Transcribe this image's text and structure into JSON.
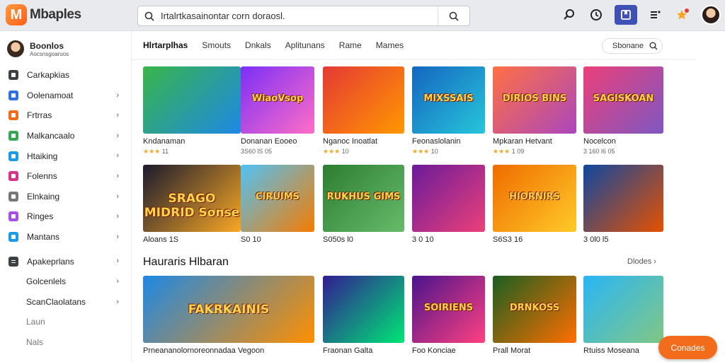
{
  "header": {
    "logo_letter": "M",
    "logo_text": "Mbaples",
    "search_value": "Irtalrtkasainontar corn doraosl.",
    "icons": [
      "magnify-icon",
      "history-icon",
      "library-icon",
      "menu-icon",
      "star-badge-icon",
      "user-avatar"
    ]
  },
  "sidebar": {
    "profile_name": "Boonlos",
    "profile_sub": "Aocsnsgoaruos",
    "items": [
      {
        "label": "Carkapkias",
        "icon_color": "#3c4043",
        "chevron": false
      },
      {
        "label": "Oolenamoat",
        "icon_color": "#2f6fde",
        "chevron": true
      },
      {
        "label": "Frtrras",
        "icon_color": "#f36c1c",
        "chevron": true
      },
      {
        "label": "Malkancaalo",
        "icon_color": "#34a853",
        "chevron": true
      },
      {
        "label": "Htaiking",
        "icon_color": "#1a9be6",
        "chevron": true
      },
      {
        "label": "Folenns",
        "icon_color": "#d63384",
        "chevron": true
      },
      {
        "label": "Elnkaing",
        "icon_color": "#777777",
        "chevron": true
      },
      {
        "label": "Ringes",
        "icon_color": "#a64ee6",
        "chevron": true
      },
      {
        "label": "Mantans",
        "icon_color": "#1a9be6",
        "chevron": true
      }
    ],
    "items2": [
      {
        "label": "Apakeprlans",
        "chevron": true
      },
      {
        "label": "Golcenlels",
        "chevron": true
      },
      {
        "label": "ScanClaolatans",
        "chevron": true
      },
      {
        "label": "Laun",
        "chevron": false
      },
      {
        "label": "Nals",
        "chevron": false
      }
    ]
  },
  "tabs": [
    "Hlrtarplhas",
    "Smouts",
    "Dnkals",
    "Aplitunans",
    "Rame",
    "Mames"
  ],
  "sort": {
    "label": "Sbonane"
  },
  "row1": [
    {
      "title": "Kndanaman",
      "meta": "11",
      "rating": 3,
      "ttl": "",
      "bg": "linear-gradient(135deg,#39b54a,#1e88e5)"
    },
    {
      "title": "Donanan Eooeo",
      "meta": "3S60 lS 05",
      "rating": 0,
      "ttl": "WiaoVsop",
      "bg": "linear-gradient(135deg,#7b2ff7,#ff6ec7)"
    },
    {
      "title": "Nganoc Inoatlat",
      "meta": "10",
      "rating": 3,
      "ttl": "",
      "bg": "linear-gradient(135deg,#e53935,#ff9800)"
    },
    {
      "title": "Feonaslolanin",
      "meta": "10",
      "rating": 3,
      "ttl": "MIXSSAIS",
      "bg": "linear-gradient(135deg,#1565c0,#26c6da)"
    },
    {
      "title": "Mpkaran Hetvant",
      "meta": "1 09",
      "rating": 3,
      "ttl": "DIRIOS BINS",
      "bg": "linear-gradient(135deg,#ff7043,#ab47bc)"
    },
    {
      "title": "Nocelcon",
      "meta": "3 160 l6 05",
      "rating": 0,
      "ttl": "SAGISKOAN",
      "bg": "linear-gradient(135deg,#ec407a,#7e57c2)"
    }
  ],
  "row2": [
    {
      "title": "Aloans 1S",
      "meta": "",
      "rating": 0,
      "ttl": "SRAGO MIDRID Sonse",
      "bg": "linear-gradient(135deg,#1a1a2e,#f9a825)"
    },
    {
      "title": "S0 10",
      "meta": "",
      "rating": 0,
      "ttl": "CIRUIMS",
      "bg": "linear-gradient(135deg,#4fc3f7,#f57c00)"
    },
    {
      "title": "S050s l0",
      "meta": "",
      "rating": 0,
      "ttl": "RUKHUS GIMS",
      "bg": "linear-gradient(135deg,#2e7d32,#66bb6a)"
    },
    {
      "title": "3 0 10",
      "meta": "",
      "rating": 0,
      "ttl": "",
      "bg": "linear-gradient(135deg,#6a1b9a,#ec407a)"
    },
    {
      "title": "S6S3 16",
      "meta": "",
      "rating": 0,
      "ttl": "HIORNIRS",
      "bg": "linear-gradient(135deg,#ef6c00,#ffca28)"
    },
    {
      "title": "3 0l0 l5",
      "meta": "",
      "rating": 0,
      "ttl": "",
      "bg": "linear-gradient(135deg,#0d47a1,#e65100)"
    }
  ],
  "section2": {
    "title": "Hauraris Hlbaran",
    "more": "Dlodes"
  },
  "row3": [
    {
      "title": "Prneananolornoreonnadaa Vegoon",
      "ttl": "FAKRKAINIS",
      "bg": "linear-gradient(135deg,#1e88e5,#ff8f00)"
    },
    {
      "title": "Fraonan Galta",
      "ttl": "",
      "bg": "linear-gradient(135deg,#311b92,#00e676)"
    },
    {
      "title": "Foo Konciae",
      "ttl": "SOIRIENS",
      "bg": "linear-gradient(135deg,#4a148c,#ff4081)"
    },
    {
      "title": "Prall Morat",
      "ttl": "DRNKOSS",
      "bg": "linear-gradient(135deg,#1b5e20,#ff6f00)"
    },
    {
      "title": "Rtuiss Moseana",
      "ttl": "",
      "bg": "linear-gradient(135deg,#29b6f6,#81c784)"
    }
  ],
  "fab": {
    "label": "Conades"
  }
}
